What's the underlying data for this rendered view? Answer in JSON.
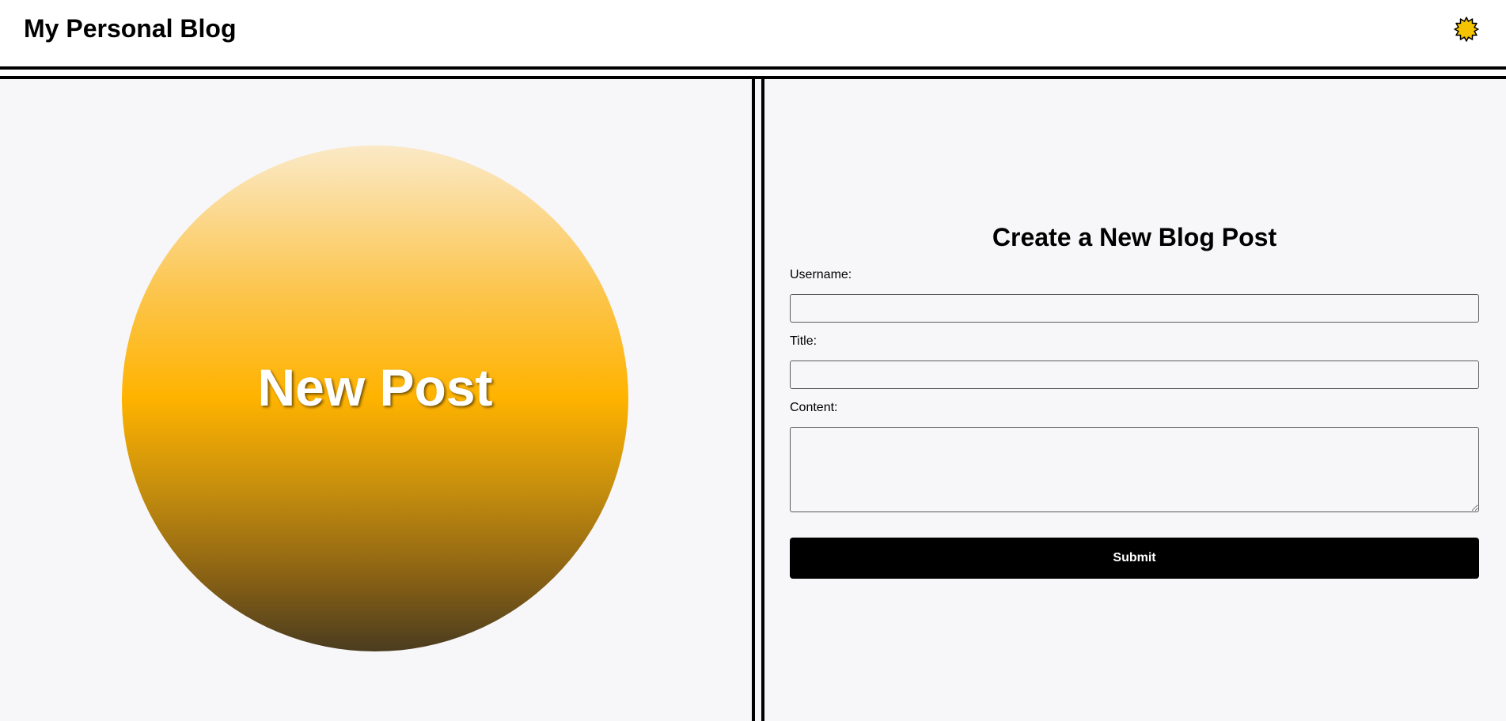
{
  "header": {
    "site_title": "My Personal Blog",
    "theme_toggle_icon": "sun-icon",
    "sun_color": "#f5c400"
  },
  "hero": {
    "circle_text": "New Post",
    "gradient_colors": [
      "#fbe9c7",
      "#fcc449",
      "#ffb300",
      "#c68e0e",
      "#8a6214",
      "#4a3c1f"
    ]
  },
  "form": {
    "heading": "Create a New Blog Post",
    "username_label": "Username:",
    "username_value": "",
    "title_label": "Title:",
    "title_value": "",
    "content_label": "Content:",
    "content_value": "",
    "submit_label": "Submit"
  },
  "colors": {
    "background": "#f7f7f9",
    "accent": "#000000",
    "header_background": "#ffffff"
  }
}
